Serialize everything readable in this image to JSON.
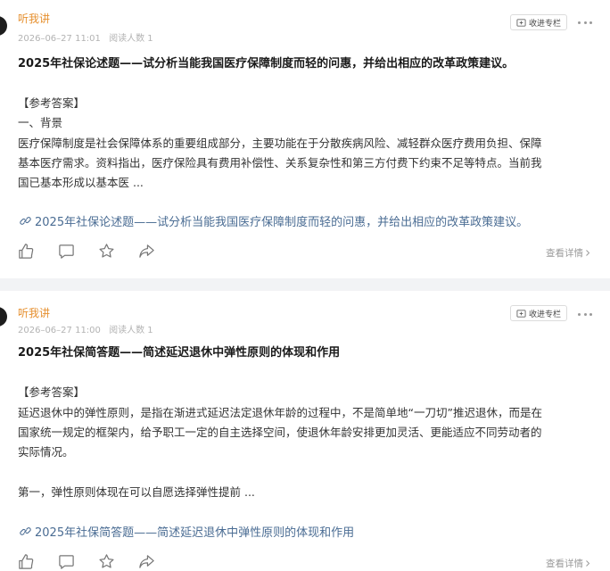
{
  "posts": [
    {
      "author": "听我讲",
      "date": "2026–06–27 11:01",
      "reads": "阅读人数 1",
      "collect_label": "收进专栏",
      "title": "2025年社保论述题——试分析当能我国医疗保障制度而轻的问惠，并给出相应的改革政策建议。",
      "lines": [
        "【参考答案】",
        "一、背景",
        "医疗保障制度是社会保障体系的重要组成部分，主要功能在于分散疾病风险、减轻群众医疗费用负担、保障",
        "基本医疗需求。资料指出，医疗保险具有费用补偿性、关系复杂性和第三方付费下约束不足等特点。当前我",
        "国已基本形成以基本医 ..."
      ],
      "link": "2025年社保论述题——试分析当能我国医疗保障制度而轻的问惠，并给出相应的改革政策建议。",
      "detail": "查看详情"
    },
    {
      "author": "听我讲",
      "date": "2026–06–27 11:00",
      "reads": "阅读人数 1",
      "collect_label": "收进专栏",
      "title": "2025年社保简答题——简述延迟退休中弹性原则的体现和作用",
      "lines": [
        "【参考答案】",
        "延迟退休中的弹性原则，是指在渐进式延迟法定退休年龄的过程中，不是简单地“一刀切”推迟退休，而是在",
        "国家统一规定的框架内，给予职工一定的自主选择空间，使退休年龄安排更加灵活、更能适应不同劳动者的",
        "实际情况。",
        "第一，弹性原则体现在可以自愿选择弹性提前 ..."
      ],
      "link": "2025年社保简答题——简述延迟退休中弹性原则的体现和作用",
      "detail": "查看详情"
    }
  ],
  "icons": {
    "like": "thumbs-up-icon",
    "comment": "comment-icon",
    "favorite": "star-icon",
    "share": "share-icon",
    "link": "link-icon",
    "collect": "collect-icon"
  },
  "colors": {
    "author": "#e6902f",
    "link": "#4a6c93",
    "meta": "#b3b3b3",
    "separator": "#f2f3f5"
  }
}
